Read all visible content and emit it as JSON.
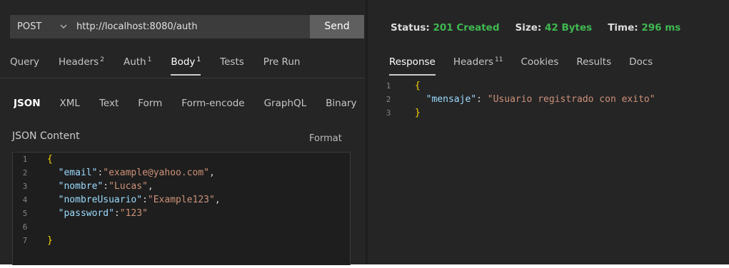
{
  "request": {
    "method": "POST",
    "url": "http://localhost:8080/auth",
    "send_label": "Send",
    "tabs": [
      {
        "label": "Query",
        "count": ""
      },
      {
        "label": "Headers",
        "count": "2"
      },
      {
        "label": "Auth",
        "count": "1"
      },
      {
        "label": "Body",
        "count": "1",
        "active": true
      },
      {
        "label": "Tests",
        "count": ""
      },
      {
        "label": "Pre Run",
        "count": ""
      }
    ],
    "body_tabs": [
      {
        "label": "JSON",
        "active": true
      },
      {
        "label": "XML"
      },
      {
        "label": "Text"
      },
      {
        "label": "Form"
      },
      {
        "label": "Form-encode"
      },
      {
        "label": "GraphQL"
      },
      {
        "label": "Binary"
      }
    ],
    "json_content_label": "JSON Content",
    "format_label": "Format",
    "body_lines": [
      {
        "n": "1",
        "tokens": [
          {
            "t": "{",
            "c": "b"
          }
        ]
      },
      {
        "n": "2",
        "tokens": [
          {
            "t": "  ",
            "c": "p"
          },
          {
            "t": "\"email\"",
            "c": "k"
          },
          {
            "t": ":",
            "c": "p"
          },
          {
            "t": "\"example@yahoo.com\"",
            "c": "s"
          },
          {
            "t": ",",
            "c": "p"
          }
        ]
      },
      {
        "n": "3",
        "tokens": [
          {
            "t": "  ",
            "c": "p"
          },
          {
            "t": "\"nombre\"",
            "c": "k"
          },
          {
            "t": ":",
            "c": "p"
          },
          {
            "t": "\"Lucas\"",
            "c": "s"
          },
          {
            "t": ",",
            "c": "p"
          }
        ]
      },
      {
        "n": "4",
        "tokens": [
          {
            "t": "  ",
            "c": "p"
          },
          {
            "t": "\"nombreUsuario\"",
            "c": "k"
          },
          {
            "t": ":",
            "c": "p"
          },
          {
            "t": "\"Example123\"",
            "c": "s"
          },
          {
            "t": ",",
            "c": "p"
          }
        ]
      },
      {
        "n": "5",
        "tokens": [
          {
            "t": "  ",
            "c": "p"
          },
          {
            "t": "\"password\"",
            "c": "k"
          },
          {
            "t": ":",
            "c": "p"
          },
          {
            "t": "\"123\"",
            "c": "s"
          }
        ]
      },
      {
        "n": "6",
        "tokens": []
      },
      {
        "n": "7",
        "tokens": [
          {
            "t": "}",
            "c": "b"
          }
        ]
      }
    ]
  },
  "response": {
    "status_label": "Status:",
    "status_value": "201 Created",
    "size_label": "Size:",
    "size_value": "42 Bytes",
    "time_label": "Time:",
    "time_value": "296 ms",
    "tabs": [
      {
        "label": "Response",
        "count": "",
        "active": true
      },
      {
        "label": "Headers",
        "count": "11"
      },
      {
        "label": "Cookies",
        "count": ""
      },
      {
        "label": "Results",
        "count": ""
      },
      {
        "label": "Docs",
        "count": ""
      }
    ],
    "body_lines": [
      {
        "n": "1",
        "tokens": [
          {
            "t": "{",
            "c": "b"
          }
        ]
      },
      {
        "n": "2",
        "tokens": [
          {
            "t": "  ",
            "c": "p"
          },
          {
            "t": "\"mensaje\"",
            "c": "k"
          },
          {
            "t": ": ",
            "c": "p"
          },
          {
            "t": "\"Usuario registrado con exito\"",
            "c": "s"
          }
        ]
      },
      {
        "n": "3",
        "tokens": [
          {
            "t": "}",
            "c": "b"
          }
        ]
      }
    ]
  },
  "colors": {
    "panel_bg": "#252526",
    "editor_bg": "#1e1e1e",
    "json_key": "#9cdcfe",
    "json_string": "#ce9178",
    "json_brace": "#ffd700",
    "status_ok": "#3fb950",
    "send_button": "#5f5f5f"
  },
  "icons": {
    "method_dropdown": "chevron-down-icon"
  }
}
